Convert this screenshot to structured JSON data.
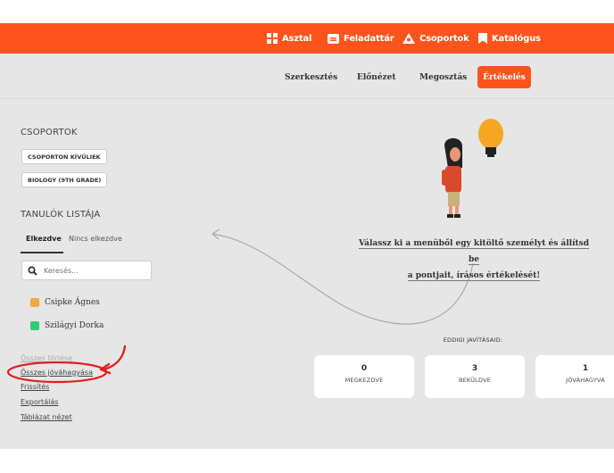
{
  "nav": {
    "items": [
      {
        "label": "Asztal",
        "icon": "dashboard-icon"
      },
      {
        "label": "Feladattár",
        "icon": "task-bank-icon"
      },
      {
        "label": "Csoportok",
        "icon": "groups-icon"
      },
      {
        "label": "Katalógus",
        "icon": "bookmark-icon"
      }
    ],
    "bg_color": "#fd541d"
  },
  "subnav": {
    "items": [
      "Szerkesztés",
      "Előnézet",
      "Megosztás",
      "Értékelés"
    ],
    "active": "Értékelés"
  },
  "sidebar": {
    "groups_title": "CSOPORTOK",
    "groups": [
      "CSOPORTON KÍVÜLIEK",
      "BIOLOGY (9TH GRADE)"
    ],
    "students_title": "TANULÓK LISTÁJA",
    "tabs": [
      "Elkezdve",
      "Nincs elkezdve"
    ],
    "search_placeholder": "Keresés...",
    "students": [
      {
        "name": "Csipke Ágnes",
        "color": "#f0a93b"
      },
      {
        "name": "Szilágyi Dorka",
        "color": "#2ecc71"
      }
    ],
    "links": [
      "Összes törlése",
      "Összes jóváhagyása",
      "Frissítés",
      "Exportálás",
      "Táblázat nézet"
    ]
  },
  "main": {
    "prompt_line1": "Válassz ki a menüből egy kitöltő személyt és állítsd be",
    "prompt_line2": "a pontjait, írásos értékelését!",
    "stats_title": "EDDIGI JAVÍTÁSAID:",
    "stats": [
      {
        "value": "0",
        "label": "MEGKEZDVE"
      },
      {
        "value": "3",
        "label": "BEKÜLDVE"
      },
      {
        "value": "1",
        "label": "JÓVÁHAGYVA"
      }
    ]
  }
}
